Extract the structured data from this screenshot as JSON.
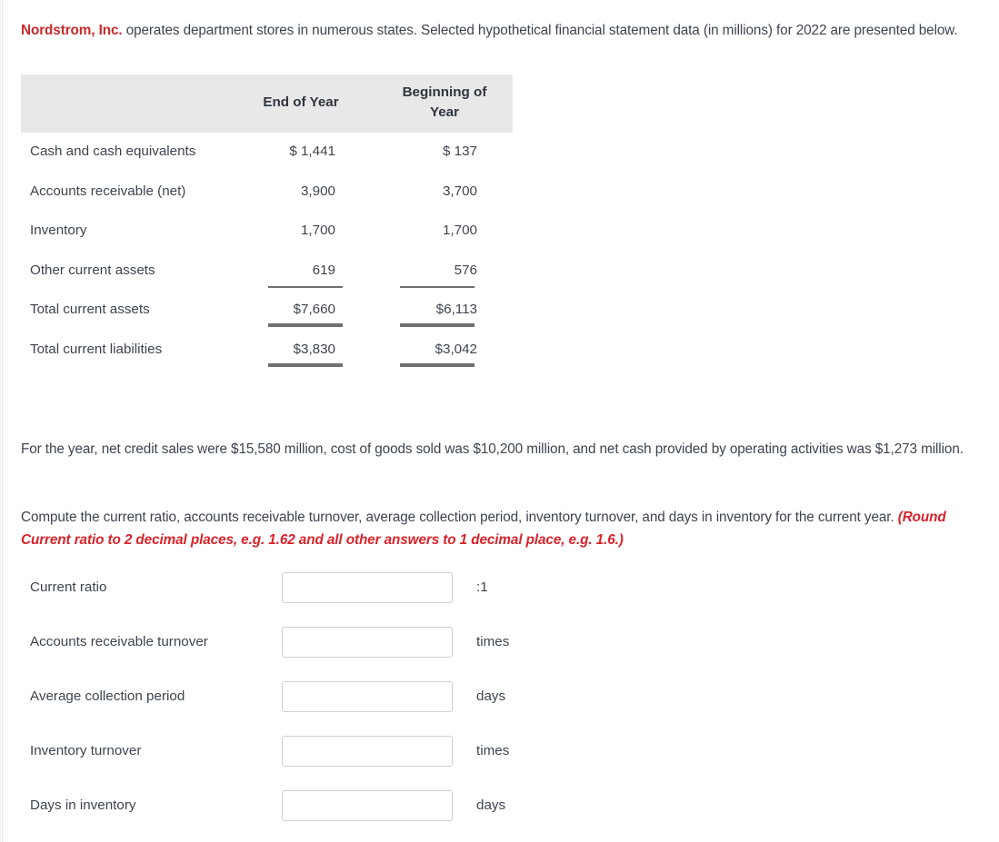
{
  "intro": {
    "company": "Nordstrom, Inc.",
    "text": " operates department stores in numerous states. Selected hypothetical financial statement data (in millions) for 2022 are presented below."
  },
  "table": {
    "columns": [
      "",
      "End of Year",
      "Beginning of Year"
    ],
    "header_col1": "End of Year",
    "header_col2": "Beginning of\nYear",
    "header_col2_line1": "Beginning of",
    "header_col2_line2": "Year",
    "rows": [
      {
        "label": "Cash and cash equivalents",
        "end_of_year": "$ 1,441",
        "beginning_of_year": "$ 137",
        "rule": "none"
      },
      {
        "label": "Accounts receivable (net)",
        "end_of_year": "3,900",
        "beginning_of_year": "3,700",
        "rule": "none"
      },
      {
        "label": "Inventory",
        "end_of_year": "1,700",
        "beginning_of_year": "1,700",
        "rule": "none"
      },
      {
        "label": "Other current assets",
        "end_of_year": "619",
        "beginning_of_year": "576",
        "rule": "single-below"
      },
      {
        "label": "Total current assets",
        "end_of_year": "$7,660",
        "beginning_of_year": "$6,113",
        "rule": "double-below"
      },
      {
        "label": "Total current liabilities",
        "end_of_year": "$3,830",
        "beginning_of_year": "$3,042",
        "rule": "double-below"
      }
    ]
  },
  "paragraphs": {
    "sales_info": "For the year, net credit sales were $15,580 million, cost of goods sold was $10,200 million, and net cash provided by operating activities was $1,273 million.",
    "instruction": "Compute the current ratio, accounts receivable turnover, average collection period, inventory turnover, and days in inventory for the current year. ",
    "rounding_note": "(Round Current ratio to 2 decimal places, e.g. 1.62 and all other answers to 1 decimal place, e.g. 1.6.)"
  },
  "form": {
    "rows": [
      {
        "label": "Current ratio",
        "value": "",
        "placeholder": "",
        "unit": ":1"
      },
      {
        "label": "Accounts receivable turnover",
        "value": "",
        "placeholder": "",
        "unit": "times"
      },
      {
        "label": "Average collection period",
        "value": "",
        "placeholder": "",
        "unit": "days"
      },
      {
        "label": "Inventory turnover",
        "value": "",
        "placeholder": "",
        "unit": "times"
      },
      {
        "label": "Days in inventory",
        "value": "",
        "placeholder": "",
        "unit": "days"
      }
    ]
  },
  "colors": {
    "company_red": "#c8292b",
    "note_red": "#d9232a",
    "text": "#3d4450",
    "table_header_bg": "#e8e8e8",
    "rule": "#6f6f6f",
    "input_border": "#ccd0d4"
  }
}
